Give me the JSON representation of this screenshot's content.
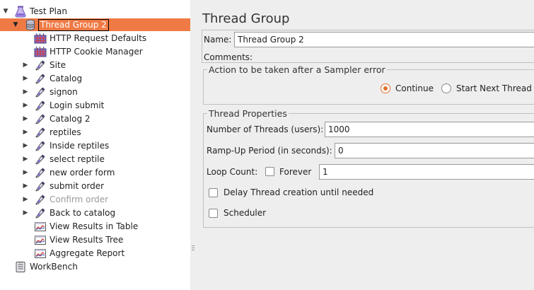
{
  "tree": {
    "root": {
      "label": "Test Plan",
      "icon": "test-plan-icon"
    },
    "group": {
      "label": "Thread Group 2",
      "icon": "thread-group-icon"
    },
    "children": [
      {
        "label": "HTTP Request Defaults",
        "icon": "config-element-icon",
        "expandable": false,
        "disabled": false
      },
      {
        "label": "HTTP Cookie Manager",
        "icon": "config-element-icon",
        "expandable": false,
        "disabled": false
      },
      {
        "label": "Site",
        "icon": "sampler-dropper-icon",
        "expandable": true,
        "disabled": false
      },
      {
        "label": "Catalog",
        "icon": "sampler-dropper-icon",
        "expandable": true,
        "disabled": false
      },
      {
        "label": "signon",
        "icon": "sampler-dropper-icon",
        "expandable": true,
        "disabled": false
      },
      {
        "label": "Login submit",
        "icon": "sampler-dropper-icon",
        "expandable": true,
        "disabled": false
      },
      {
        "label": "Catalog 2",
        "icon": "sampler-dropper-icon",
        "expandable": true,
        "disabled": false
      },
      {
        "label": "reptiles",
        "icon": "sampler-dropper-icon",
        "expandable": true,
        "disabled": false
      },
      {
        "label": "Inside reptiles",
        "icon": "sampler-dropper-icon",
        "expandable": true,
        "disabled": false
      },
      {
        "label": "select reptile",
        "icon": "sampler-dropper-icon",
        "expandable": true,
        "disabled": false
      },
      {
        "label": "new order form",
        "icon": "sampler-dropper-icon",
        "expandable": true,
        "disabled": false
      },
      {
        "label": "submit order",
        "icon": "sampler-dropper-icon",
        "expandable": true,
        "disabled": false
      },
      {
        "label": "Confirm order",
        "icon": "sampler-dropper-icon",
        "expandable": true,
        "disabled": true
      },
      {
        "label": "Back to catalog",
        "icon": "sampler-dropper-icon",
        "expandable": true,
        "disabled": false
      },
      {
        "label": "View Results in Table",
        "icon": "listener-chart-icon",
        "expandable": false,
        "disabled": false
      },
      {
        "label": "View Results Tree",
        "icon": "listener-chart-icon",
        "expandable": false,
        "disabled": false
      },
      {
        "label": "Aggregate Report",
        "icon": "listener-chart-icon",
        "expandable": false,
        "disabled": false
      }
    ],
    "workbench": {
      "label": "WorkBench",
      "icon": "workbench-icon"
    }
  },
  "panel": {
    "title": "Thread Group",
    "name_label": "Name:",
    "name_value": "Thread Group 2",
    "comments_label": "Comments:",
    "sampler_error": {
      "legend": "Action to be taken after a Sampler error",
      "options": [
        {
          "label": "Continue",
          "selected": true
        },
        {
          "label": "Start Next Thread",
          "selected": false
        }
      ]
    },
    "thread_properties": {
      "legend": "Thread Properties",
      "threads_label": "Number of Threads (users):",
      "threads_value": "1000",
      "rampup_label": "Ramp-Up Period (in seconds):",
      "rampup_value": "0",
      "loop_label": "Loop Count:",
      "forever_label": "Forever",
      "forever_checked": false,
      "loop_value": "1",
      "delay_label": "Delay Thread creation until needed",
      "delay_checked": false,
      "scheduler_label": "Scheduler",
      "scheduler_checked": false
    }
  },
  "colors": {
    "selection": "#ef7a45",
    "radio_selected": "#e07030"
  }
}
